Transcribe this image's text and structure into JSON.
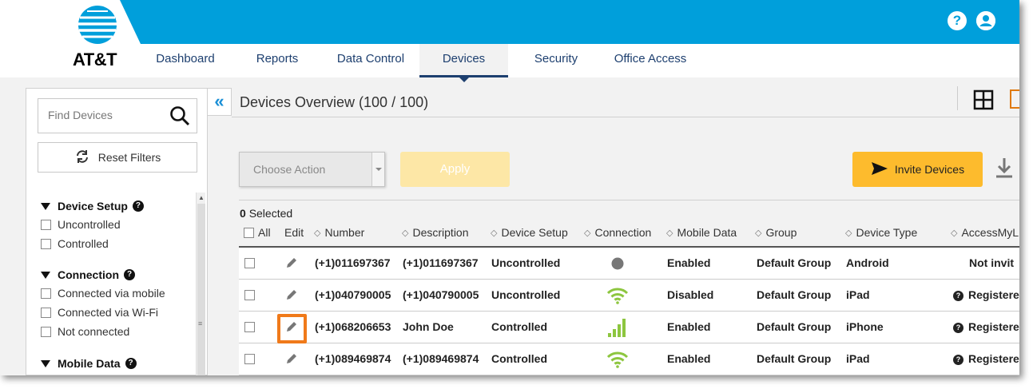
{
  "brand": {
    "name": "AT&T",
    "blue": "#009fdb",
    "navy": "#1d3f6f",
    "accent": "#fdbb2d"
  },
  "header": {
    "help_icon": "question-icon",
    "user_icon": "user-icon"
  },
  "nav": [
    "Dashboard",
    "Reports",
    "Data Control",
    "Devices",
    "Security",
    "Office Access"
  ],
  "nav_active": "Devices",
  "sidebar": {
    "search_placeholder": "Find Devices",
    "reset_label": "Reset Filters",
    "groups": [
      {
        "title": "Device Setup",
        "options": [
          "Uncontrolled",
          "Controlled"
        ]
      },
      {
        "title": "Connection",
        "options": [
          "Connected via mobile",
          "Connected via Wi-Fi",
          "Not connected"
        ]
      },
      {
        "title": "Mobile Data",
        "options": []
      }
    ]
  },
  "main": {
    "title": "Devices Overview (100 / 100)",
    "choose_action": "Choose Action",
    "apply": "Apply",
    "invite": "Invite Devices",
    "selected_count": "0",
    "selected_label": "Selected"
  },
  "table": {
    "columns": [
      "All",
      "Edit",
      "Number",
      "Description",
      "Device Setup",
      "Connection",
      "Mobile Data",
      "Group",
      "Device Type",
      "AccessMyL"
    ],
    "rows": [
      {
        "number": "(+1)011697367",
        "description": "(+1)011697367",
        "setup": "Uncontrolled",
        "connection": "not-connected",
        "mobile_data": "Enabled",
        "group": "Default Group",
        "type": "Android",
        "access": "Not invit"
      },
      {
        "number": "(+1)040790005",
        "description": "(+1)040790005",
        "setup": "Uncontrolled",
        "connection": "wifi",
        "mobile_data": "Disabled",
        "group": "Default Group",
        "type": "iPad",
        "access": "Registere"
      },
      {
        "number": "(+1)068206653",
        "description": "John Doe",
        "setup": "Controlled",
        "connection": "mobile",
        "mobile_data": "Enabled",
        "group": "Default Group",
        "type": "iPhone",
        "access": "Registere"
      },
      {
        "number": "(+1)089469874",
        "description": "(+1)089469874",
        "setup": "Controlled",
        "connection": "wifi",
        "mobile_data": "Enabled",
        "group": "Default Group",
        "type": "iPad",
        "access": "Registere"
      }
    ]
  }
}
